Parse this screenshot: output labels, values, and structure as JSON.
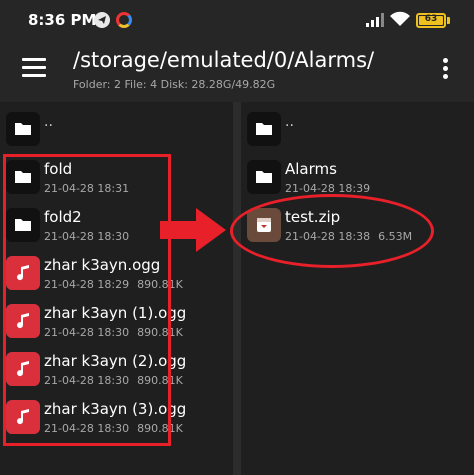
{
  "status": {
    "time": "8:36 PM",
    "battery": "63"
  },
  "toolbar": {
    "path": "/storage/emulated/0/Alarms/",
    "info": "Folder: 2  File: 4  Disk: 28.28G/49.82G"
  },
  "left_pane": {
    "up_label": "..",
    "items": [
      {
        "name": "fold",
        "date": "21-04-28 18:31",
        "size": "",
        "type": "folder"
      },
      {
        "name": "fold2",
        "date": "21-04-28 18:30",
        "size": "",
        "type": "folder"
      },
      {
        "name": "zhar k3ayn.ogg",
        "date": "21-04-28 18:29",
        "size": "890.81K",
        "type": "audio"
      },
      {
        "name": "zhar k3ayn (1).ogg",
        "date": "21-04-28 18:30",
        "size": "890.81K",
        "type": "audio"
      },
      {
        "name": "zhar k3ayn (2).ogg",
        "date": "21-04-28 18:30",
        "size": "890.81K",
        "type": "audio"
      },
      {
        "name": "zhar k3ayn (3).ogg",
        "date": "21-04-28 18:30",
        "size": "890.81K",
        "type": "audio"
      }
    ]
  },
  "right_pane": {
    "up_label": "..",
    "items": [
      {
        "name": "Alarms",
        "date": "21-04-28 18:39",
        "size": "",
        "type": "folder"
      },
      {
        "name": "test.zip",
        "date": "21-04-28 18:38",
        "size": "6.53M",
        "type": "zip"
      }
    ]
  },
  "colors": {
    "annotation": "#e8202a",
    "audio_tile": "#d9303c",
    "zip_tile": "#6a4a3a",
    "background": "#1f1f1f"
  }
}
